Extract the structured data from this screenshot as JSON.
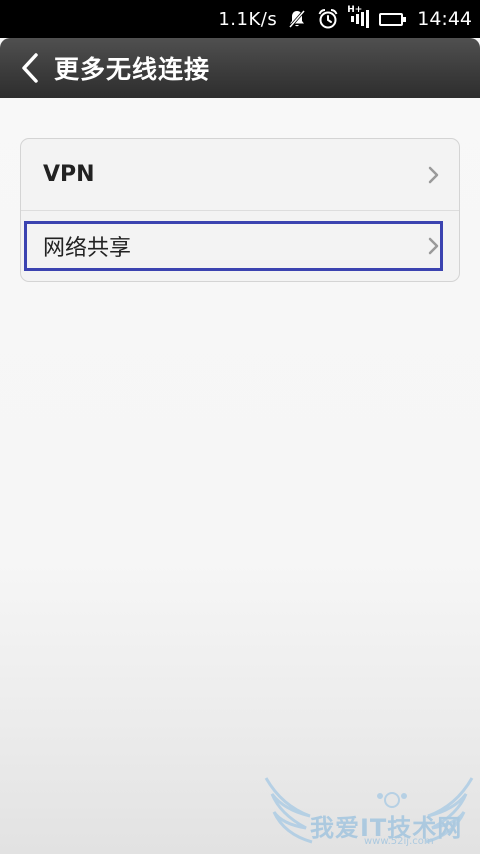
{
  "status_bar": {
    "net_speed": "1.1K/s",
    "signal_type": "H+",
    "time": "14:44",
    "icons": [
      "notification-off-icon",
      "alarm-icon",
      "signal-icon",
      "battery-icon"
    ]
  },
  "title_bar": {
    "title": "更多无线连接",
    "back_icon": "chevron-left-icon"
  },
  "menu": {
    "items": [
      {
        "label": "VPN",
        "icon": "chevron-right-icon"
      },
      {
        "label": "网络共享",
        "icon": "chevron-right-icon",
        "highlighted": true
      }
    ]
  },
  "watermark": {
    "text": "我爱IT技术网",
    "sub": "www.52ij.com"
  },
  "colors": {
    "title_bar": "#3c3c3c",
    "highlight_border": "#3b43b0",
    "background": "#f6f6f6"
  }
}
